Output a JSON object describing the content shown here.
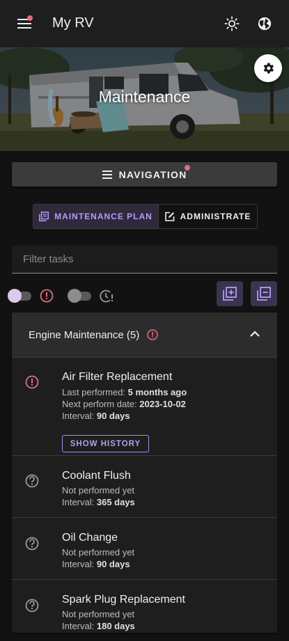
{
  "appbar": {
    "title": "My RV"
  },
  "hero": {
    "title": "Maintenance"
  },
  "navigation": {
    "label": "NAVIGATION"
  },
  "tabs": {
    "plan": "MAINTENANCE PLAN",
    "admin": "ADMINISTRATE"
  },
  "filter": {
    "placeholder": "Filter tasks",
    "value": ""
  },
  "group": {
    "title": "Engine Maintenance (5)"
  },
  "tasks": [
    {
      "name": "Air Filter Replacement",
      "status": "alert",
      "line1_label": "Last performed: ",
      "line1_value": "5 months ago",
      "line2_label": "Next perform date: ",
      "line2_value": "2023-10-02",
      "line3_label": "Interval: ",
      "line3_value": "90 days",
      "history_label": "SHOW HISTORY"
    },
    {
      "name": "Coolant Flush",
      "status": "unknown",
      "line1": "Not performed yet",
      "line2_label": "Interval: ",
      "line2_value": "365 days"
    },
    {
      "name": "Oil Change",
      "status": "unknown",
      "line1": "Not performed yet",
      "line2_label": "Interval: ",
      "line2_value": "90 days"
    },
    {
      "name": "Spark Plug Replacement",
      "status": "unknown",
      "line1": "Not performed yet",
      "line2_label": "Interval: ",
      "line2_value": "180 days"
    }
  ],
  "colors": {
    "accent": "#b69cf5",
    "alert": "#e26d7f",
    "background": "#121212"
  }
}
